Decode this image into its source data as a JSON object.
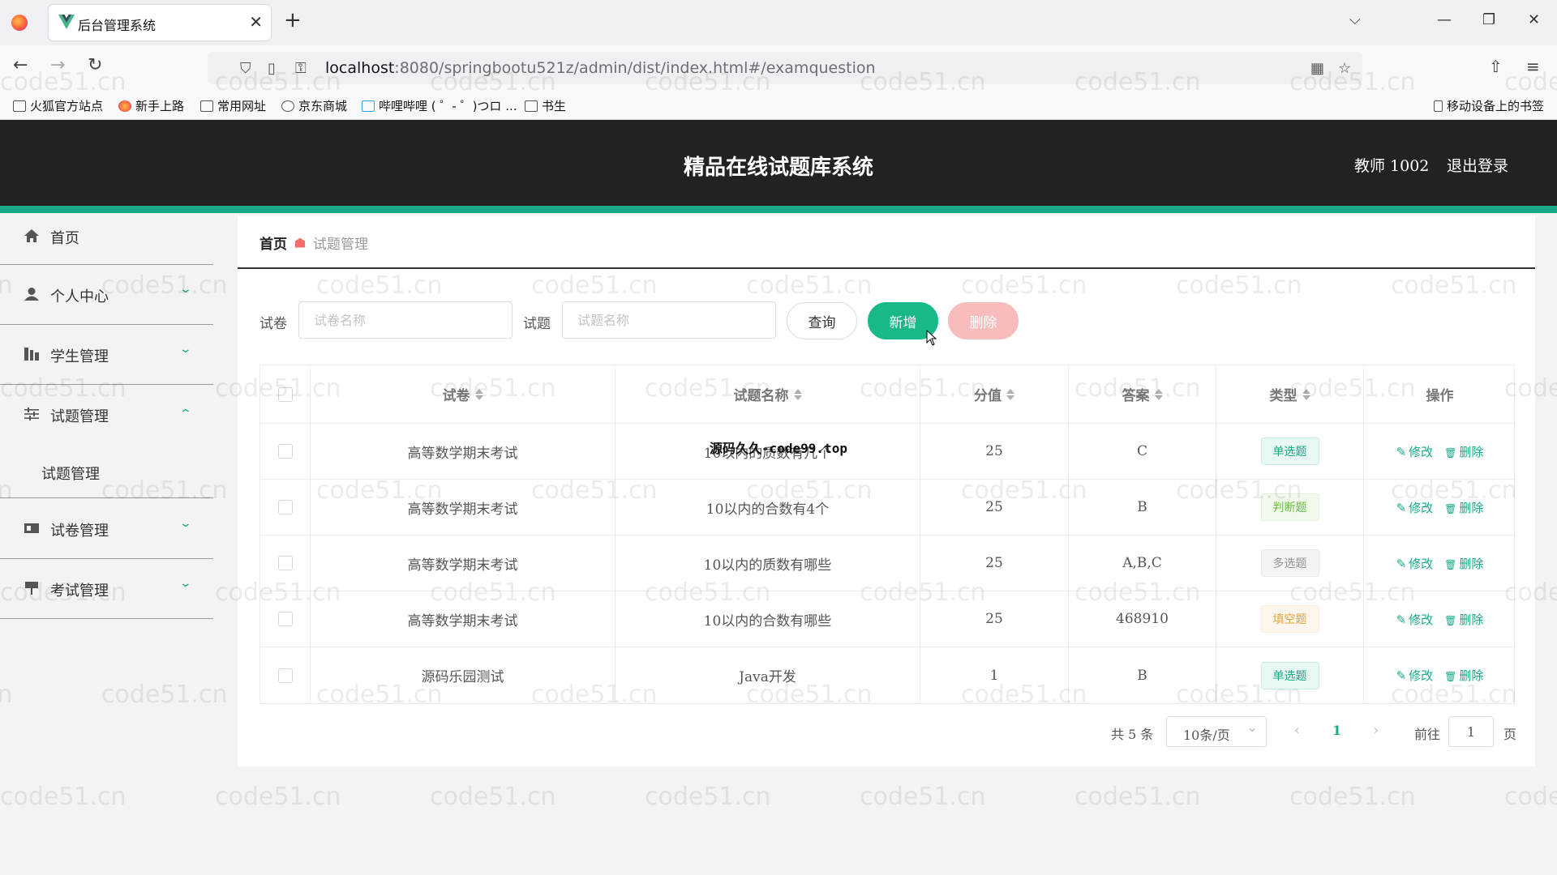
{
  "browser": {
    "tab_title": "后台管理系统",
    "url_host": "localhost",
    "url_rest": ":8080/springbootu521z/admin/dist/index.html#/examquestion",
    "bookmarks": [
      "火狐官方站点",
      "新手上路",
      "常用网址",
      "京东商城",
      "哔哩哔哩 ( ゜- ゜)つロ ...",
      "书生"
    ],
    "mobile_bookmarks": "移动设备上的书签"
  },
  "header": {
    "title": "精品在线试题库系统",
    "user": "教师 1002",
    "logout": "退出登录"
  },
  "sidebar": {
    "items": [
      {
        "label": "首页",
        "icon": "home-icon"
      },
      {
        "label": "个人中心",
        "icon": "user-icon"
      },
      {
        "label": "学生管理",
        "icon": "student-icon"
      },
      {
        "label": "试题管理",
        "icon": "sliders-icon"
      },
      {
        "label": "试卷管理",
        "icon": "paper-icon"
      },
      {
        "label": "考试管理",
        "icon": "exam-icon"
      }
    ],
    "submenu_label": "试题管理"
  },
  "breadcrumb": {
    "home": "首页",
    "current": "试题管理"
  },
  "search": {
    "paper_label": "试卷",
    "paper_placeholder": "试卷名称",
    "question_label": "试题",
    "question_placeholder": "试题名称",
    "query_button": "查询",
    "add_button": "新增",
    "delete_button": "删除"
  },
  "table": {
    "headers": {
      "paper": "试卷",
      "question": "试题名称",
      "score": "分值",
      "answer": "答案",
      "type": "类型",
      "actions": "操作"
    },
    "edit_label": "修改",
    "delete_label": "删除",
    "rows": [
      {
        "paper": "高等数学期末考试",
        "question": "10以内的质数有几个",
        "score": "25",
        "answer": "C",
        "type": "单选题"
      },
      {
        "paper": "高等数学期末考试",
        "question": "10以内的合数有4个",
        "score": "25",
        "answer": "B",
        "type": "判断题"
      },
      {
        "paper": "高等数学期末考试",
        "question": "10以内的质数有哪些",
        "score": "25",
        "answer": "A,B,C",
        "type": "多选题"
      },
      {
        "paper": "高等数学期末考试",
        "question": "10以内的合数有哪些",
        "score": "25",
        "answer": "468910",
        "type": "填空题"
      },
      {
        "paper": "源码乐园测试",
        "question": "Java开发",
        "score": "1",
        "answer": "B",
        "type": "单选题"
      }
    ]
  },
  "overlay_text": "源码久久-code99.top",
  "watermark": "code51.cn",
  "pagination": {
    "total": "共 5 条",
    "page_size": "10条/页",
    "current_page": "1",
    "goto_label": "前往",
    "goto_value": "1",
    "page_suffix": "页"
  },
  "colors": {
    "accent": "#19a989",
    "add_button": "#19b888",
    "delete_button": "#f8bcbc",
    "header_bg": "#222222"
  }
}
